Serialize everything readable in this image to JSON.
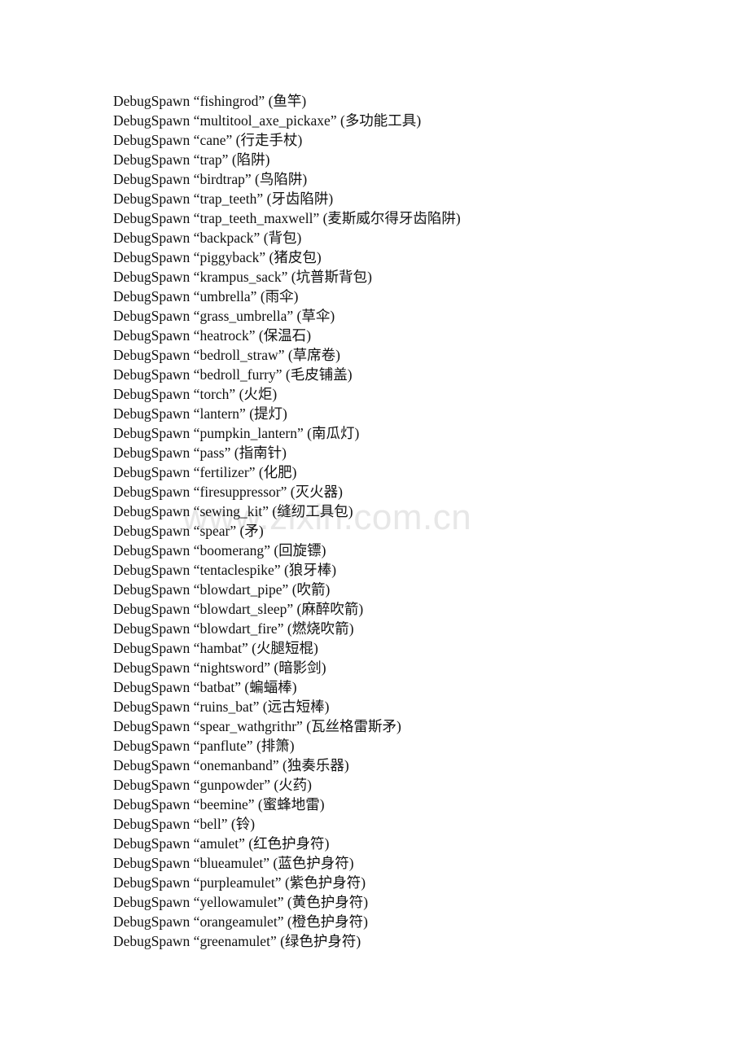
{
  "page": {
    "background_color": "#ffffff",
    "text_color": "#111111"
  },
  "watermark": {
    "text": "www.zixin.com.cn",
    "color": "#e7e7e7"
  },
  "document": {
    "command_keyword": "DebugSpawn",
    "quote_open": "“",
    "quote_close": "”",
    "paren_open": "(",
    "paren_close": ")",
    "lines": [
      {
        "keyword": "DebugSpawn",
        "id": "fishingrod",
        "cn": "鱼竿"
      },
      {
        "keyword": "DebugSpawn",
        "id": "multitool_axe_pickaxe",
        "cn": "多功能工具"
      },
      {
        "keyword": "DebugSpawn",
        "id": "cane",
        "cn": "行走手杖"
      },
      {
        "keyword": "DebugSpawn",
        "id": "trap",
        "cn": "陷阱"
      },
      {
        "keyword": "DebugSpawn",
        "id": "birdtrap",
        "cn": "鸟陷阱"
      },
      {
        "keyword": "DebugSpawn",
        "id": "trap_teeth",
        "cn": "牙齿陷阱"
      },
      {
        "keyword": "DebugSpawn",
        "id": "trap_teeth_maxwell",
        "cn": "麦斯威尔得牙齿陷阱"
      },
      {
        "keyword": "DebugSpawn",
        "id": "backpack",
        "cn": "背包"
      },
      {
        "keyword": "DebugSpawn",
        "id": "piggyback",
        "cn": "猪皮包"
      },
      {
        "keyword": "DebugSpawn",
        "id": "krampus_sack",
        "cn": "坑普斯背包"
      },
      {
        "keyword": "DebugSpawn",
        "id": "umbrella",
        "cn": "雨伞"
      },
      {
        "keyword": "DebugSpawn",
        "id": "grass_umbrella",
        "cn": "草伞"
      },
      {
        "keyword": "DebugSpawn",
        "id": "heatrock",
        "cn": "保温石"
      },
      {
        "keyword": "DebugSpawn",
        "id": "bedroll_straw",
        "cn": "草席卷"
      },
      {
        "keyword": "DebugSpawn",
        "id": "bedroll_furry",
        "cn": "毛皮铺盖"
      },
      {
        "keyword": "DebugSpawn",
        "id": "torch",
        "cn": "火炬"
      },
      {
        "keyword": "DebugSpawn",
        "id": "lantern",
        "cn": "提灯"
      },
      {
        "keyword": "DebugSpawn",
        "id": "pumpkin_lantern",
        "cn": "南瓜灯"
      },
      {
        "keyword": "DebugSpawn",
        "id": "pass",
        "cn": "指南针"
      },
      {
        "keyword": "DebugSpawn",
        "id": "fertilizer",
        "cn": "化肥"
      },
      {
        "keyword": "DebugSpawn",
        "id": "firesuppressor",
        "cn": "灭火器"
      },
      {
        "keyword": "DebugSpawn",
        "id": "sewing_kit",
        "cn": "缝纫工具包"
      },
      {
        "keyword": "DebugSpawn",
        "id": "spear",
        "cn": "矛"
      },
      {
        "keyword": "DebugSpawn",
        "id": "boomerang",
        "cn": "回旋镖"
      },
      {
        "keyword": "DebugSpawn",
        "id": "tentaclespike",
        "cn": "狼牙棒"
      },
      {
        "keyword": "DebugSpawn",
        "id": "blowdart_pipe",
        "cn": "吹箭"
      },
      {
        "keyword": "DebugSpawn",
        "id": "blowdart_sleep",
        "cn": "麻醉吹箭"
      },
      {
        "keyword": "DebugSpawn",
        "id": "blowdart_fire",
        "cn": "燃烧吹箭"
      },
      {
        "keyword": "DebugSpawn",
        "id": "hambat",
        "cn": "火腿短棍"
      },
      {
        "keyword": "DebugSpawn",
        "id": "nightsword",
        "cn": "暗影剑"
      },
      {
        "keyword": "DebugSpawn",
        "id": "batbat",
        "cn": "蝙蝠棒"
      },
      {
        "keyword": "DebugSpawn",
        "id": "ruins_bat",
        "cn": "远古短棒"
      },
      {
        "keyword": "DebugSpawn",
        "id": "spear_wathgrithr",
        "cn": "瓦丝格雷斯矛"
      },
      {
        "keyword": "DebugSpawn",
        "id": "panflute",
        "cn": "排箫"
      },
      {
        "keyword": "DebugSpawn",
        "id": "onemanband",
        "cn": "独奏乐器"
      },
      {
        "keyword": "DebugSpawn",
        "id": "gunpowder",
        "cn": "火药"
      },
      {
        "keyword": "DebugSpawn",
        "id": "beemine",
        "cn": "蜜蜂地雷"
      },
      {
        "keyword": "DebugSpawn",
        "id": "bell",
        "cn": "铃"
      },
      {
        "keyword": "DebugSpawn",
        "id": "amulet",
        "cn": "红色护身符"
      },
      {
        "keyword": "DebugSpawn",
        "id": "blueamulet",
        "cn": "蓝色护身符"
      },
      {
        "keyword": "DebugSpawn",
        "id": "purpleamulet",
        "cn": "紫色护身符"
      },
      {
        "keyword": "DebugSpawn",
        "id": "yellowamulet",
        "cn": "黄色护身符"
      },
      {
        "keyword": "DebugSpawn",
        "id": "orangeamulet",
        "cn": "橙色护身符"
      },
      {
        "keyword": "DebugSpawn",
        "id": "greenamulet",
        "cn": "绿色护身符"
      }
    ]
  }
}
